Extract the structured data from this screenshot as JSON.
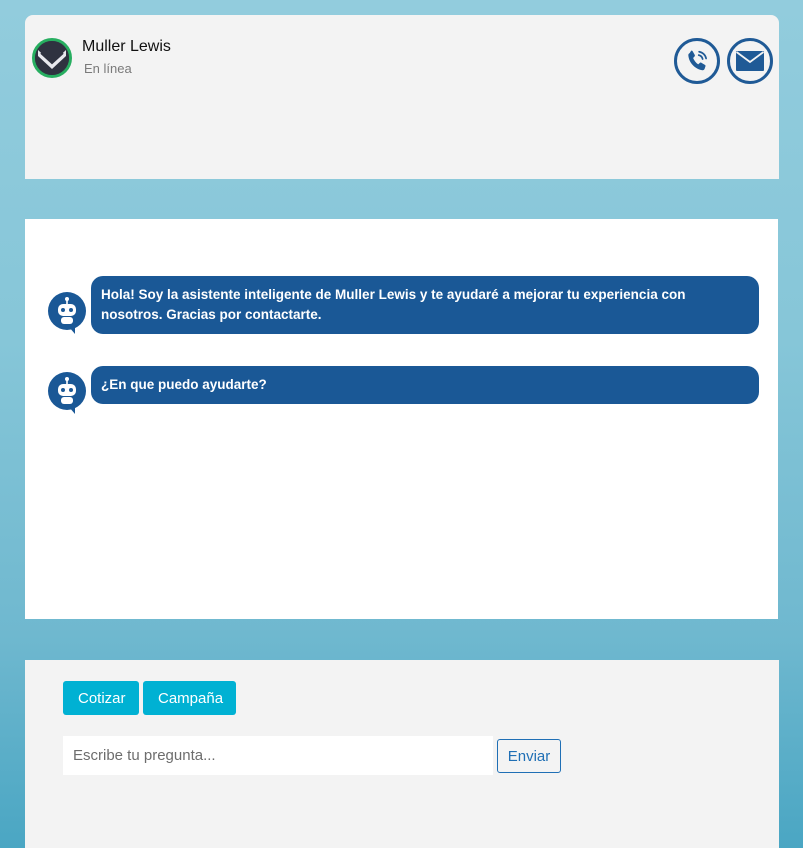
{
  "header": {
    "name": "Muller Lewis",
    "status": "En línea",
    "phone_icon": "phone-icon",
    "mail_icon": "mail-icon"
  },
  "messages": [
    {
      "sender": "bot",
      "text": "Hola! Soy la asistente inteligente de Muller Lewis y te ayudaré a mejorar tu experiencia con nosotros. Gracias por contactarte."
    },
    {
      "sender": "bot",
      "text": "¿En que puedo ayudarte?"
    }
  ],
  "footer": {
    "quick_replies": [
      "Cotizar",
      "Campaña"
    ],
    "input_placeholder": "Escribe tu pregunta...",
    "send_label": "Enviar"
  },
  "colors": {
    "brand_blue": "#1a5896",
    "accent_cyan": "#00b1d3",
    "online_green": "#27ae60"
  }
}
